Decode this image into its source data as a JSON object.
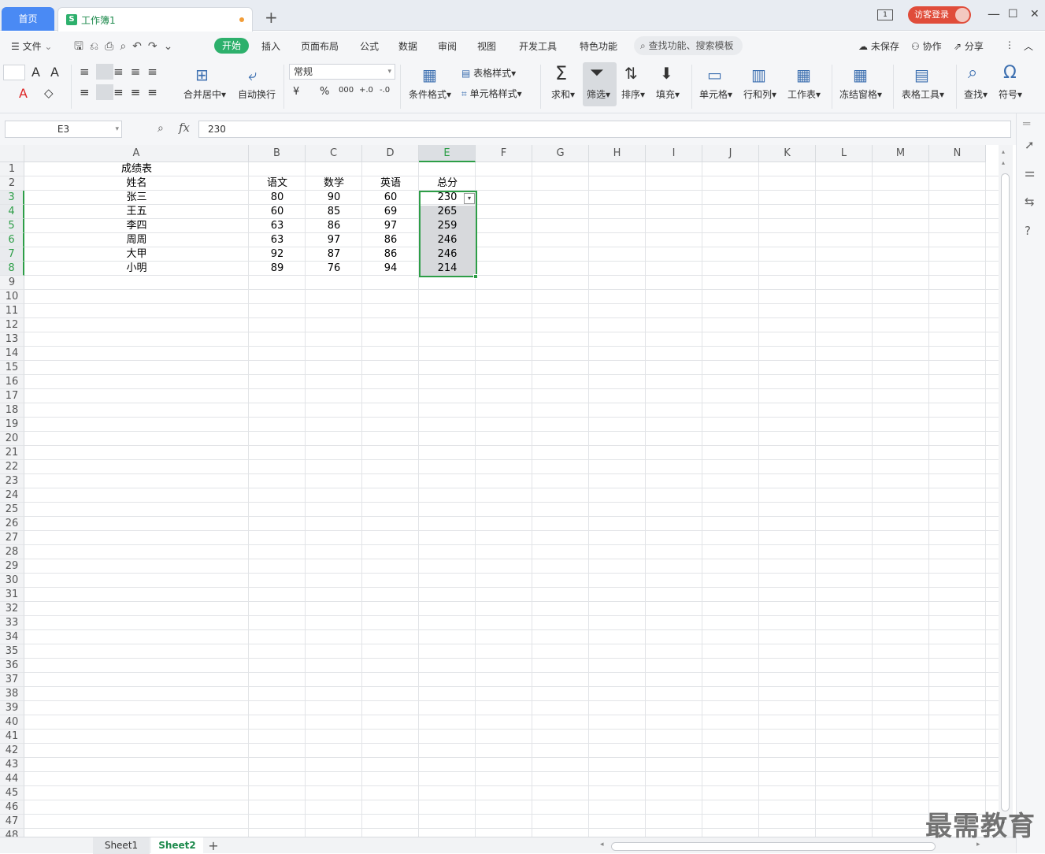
{
  "tabs": {
    "home": "首页",
    "doc": "工作簿1",
    "new": "+"
  },
  "window": {
    "login": "访客登录",
    "reader": "1",
    "min": "—",
    "max": "☐",
    "close": "✕"
  },
  "menu": {
    "file": "文件",
    "items": [
      "开始",
      "插入",
      "页面布局",
      "公式",
      "数据",
      "审阅",
      "视图",
      "开发工具",
      "特色功能"
    ],
    "search": "查找功能、搜索模板",
    "unsaved": "未保存",
    "collab": "协作",
    "share": "分享"
  },
  "toolbar": {
    "merge": "合并居中",
    "wrap": "自动换行",
    "format": "常规",
    "cond_format": "条件格式",
    "table_style": "表格样式",
    "cell_style": "单元格样式",
    "sum": "求和",
    "filter": "筛选",
    "sort": "排序",
    "fill": "填充",
    "cell": "单元格",
    "rowcol": "行和列",
    "sheet": "工作表",
    "freeze": "冻结窗格",
    "table_tools": "表格工具",
    "find": "查找",
    "symbol": "符号",
    "currency": "¥",
    "percent": "%",
    "thousands": "000",
    "dec_inc": "+.0",
    "dec_dec": "-.0"
  },
  "formula": {
    "name_box": "E3",
    "fx": "fx",
    "value": "230"
  },
  "columns": [
    "A",
    "B",
    "C",
    "D",
    "E",
    "F",
    "G",
    "H",
    "I",
    "J",
    "K",
    "L",
    "M",
    "N"
  ],
  "rows": [
    "1",
    "2",
    "3",
    "4",
    "5",
    "6",
    "7",
    "8",
    "9",
    "10",
    "11",
    "12",
    "13",
    "14",
    "15",
    "16",
    "17",
    "18",
    "19",
    "20",
    "21",
    "22",
    "23",
    "24",
    "25",
    "26",
    "27",
    "28",
    "29",
    "30",
    "31",
    "32",
    "33",
    "34",
    "35",
    "36",
    "37",
    "38",
    "39",
    "40",
    "41",
    "42",
    "43",
    "44",
    "45",
    "46",
    "47",
    "48"
  ],
  "sheet": {
    "title": "成绩表",
    "headers": [
      "姓名",
      "语文",
      "数学",
      "英语",
      "总分"
    ],
    "data": [
      [
        "张三",
        "80",
        "90",
        "60",
        "230"
      ],
      [
        "王五",
        "60",
        "85",
        "69",
        "265"
      ],
      [
        "李四",
        "63",
        "86",
        "97",
        "259"
      ],
      [
        "周周",
        "63",
        "97",
        "86",
        "246"
      ],
      [
        "大甲",
        "92",
        "87",
        "86",
        "246"
      ],
      [
        "小明",
        "89",
        "76",
        "94",
        "214"
      ]
    ]
  },
  "sheets": [
    "Sheet1",
    "Sheet2"
  ],
  "watermark": "最需教育",
  "colors": {
    "accent": "#2db06c",
    "selection": "#2d9e47",
    "home_tab": "#4a8af4",
    "login": "#e04c3a"
  }
}
